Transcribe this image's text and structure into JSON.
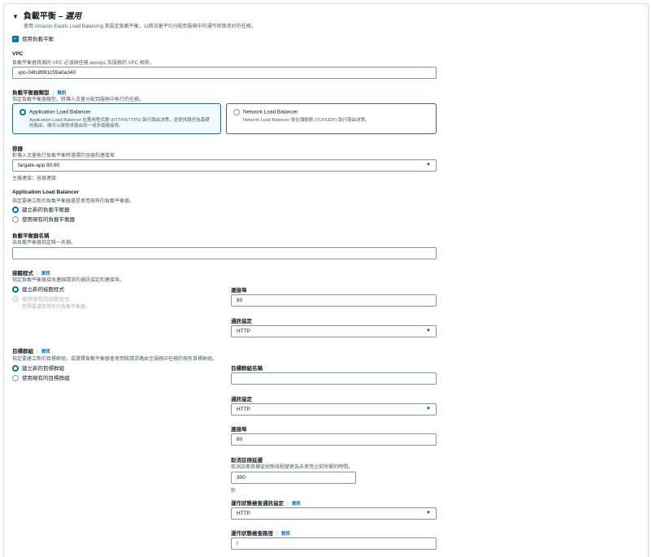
{
  "section": {
    "title_prefix": "負載平衡 – ",
    "title_italic": "選用",
    "description": "使用 Amazon Elastic Load Balancing 來設定負載平衡，以將流量平均分配到服務中的運作狀態良好的任務。",
    "use_lb_label": "使用負載平衡"
  },
  "vpc": {
    "label": "VPC",
    "description": "負載平衡器資源的 VPC 必須與任務 awsvpc 及服務的 VPC 相界。",
    "value": "vpc-04fc8991c59a0a340"
  },
  "lb_type": {
    "label": "負載平衡器類型",
    "info": "資訊",
    "description": "指定負載平衡器類型，將傳入流量分配到服務中執行的任務。",
    "options": [
      {
        "title": "Application Load Balancer",
        "desc": "Application Load Balancer 在應用程式層 (HTTP/HTTPS) 執行路由決策，並提供路徑為基礎的路由，讓可以將請求路由到一或多個連接埠。"
      },
      {
        "title": "Network Load Balancer",
        "desc": "Network Load Balancer 會在傳輸層 (TCP/UDP) 執行路由決策。"
      }
    ]
  },
  "container": {
    "label": "容器",
    "description": "對傳入流量執行負載平衡時選擇的容器和連接埠",
    "value": "fargate-app 80:80",
    "hint": "主機連接：容器連接"
  },
  "alb": {
    "label": "Application Load Balancer",
    "description": "指定要建立新的負載平衡器還是使用現有的負載平衡器。",
    "options": [
      "建立新的負載平衡器",
      "使用現有的負載平衡器"
    ]
  },
  "lb_name": {
    "label": "負載平衡器名稱",
    "description": "為負載平衡器指定唯一名稱。",
    "value": ""
  },
  "listener": {
    "label": "接聽程式",
    "info": "資訊",
    "description": "指定負載平衡器接收連線請求的通訊協定和連接埠。",
    "options": [
      "建立新的接聽程式",
      "使用現有的接聽程式"
    ],
    "existing_note": "您需要選取現有的負載平衡器。",
    "port_label": "連接埠",
    "port_value": "80",
    "protocol_label": "通訊協定",
    "protocol_value": "HTTP"
  },
  "target_group": {
    "label": "目標群組",
    "info": "資訊",
    "description": "指定要建立新的目標群組，或選擇負載平衡器會使用將請求路由至服務中任務的現有目標群組。",
    "options": [
      "建立新的目標群組",
      "使用現有的目標群組"
    ],
    "name_label": "目標群組名稱",
    "name_value": "",
    "protocol_label": "通訊協定",
    "protocol_value": "HTTP",
    "port_label": "連接埠",
    "port_value": "80",
    "dereg_label": "取消註冊延遲",
    "dereg_description": "取消註冊目標從狀態排程變更為未使用之前所需的時間。",
    "dereg_value": "300",
    "dereg_unit": "秒",
    "hc_protocol_label": "運作狀態檢查通訊協定",
    "hc_protocol_info": "資訊",
    "hc_protocol_value": "HTTP",
    "hc_path_label": "運作狀態檢查路徑",
    "hc_path_info": "資訊",
    "hc_path_value": "/"
  }
}
